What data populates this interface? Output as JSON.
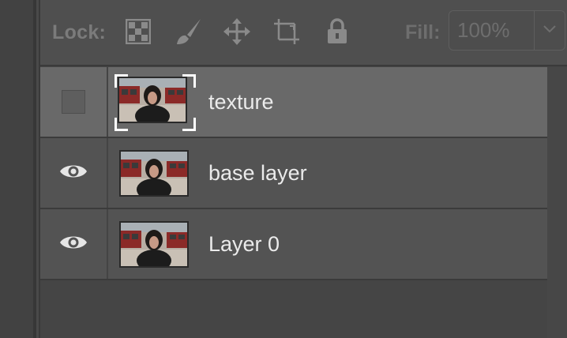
{
  "lock_bar": {
    "label": "Lock:",
    "icons": [
      "lock-transparent-pixels-icon",
      "lock-image-pixels-icon",
      "lock-position-icon",
      "lock-artboard-icon",
      "lock-all-icon"
    ],
    "fill_label": "Fill:",
    "fill_value": "100%"
  },
  "layers": [
    {
      "name": "texture",
      "visible": false,
      "selected": true
    },
    {
      "name": "base layer",
      "visible": true,
      "selected": false
    },
    {
      "name": "Layer 0",
      "visible": true,
      "selected": false
    }
  ],
  "colors": {
    "panel_bg": "#454545",
    "row_bg": "#535353",
    "selected_row_bg": "#696969",
    "text": "#ebebeb",
    "muted_text": "#7b7b7b"
  }
}
